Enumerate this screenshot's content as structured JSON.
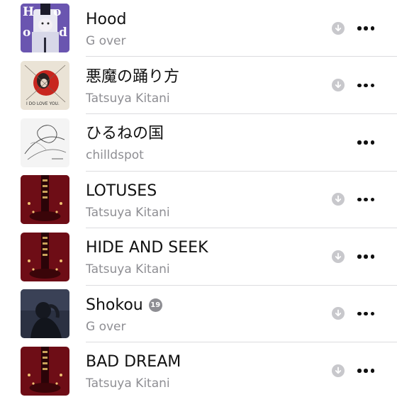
{
  "songs": [
    {
      "title": "Hood",
      "artist": "G over",
      "art": "hood-cover-art",
      "explicit": false,
      "download": true
    },
    {
      "title": "悪魔の踊り方",
      "artist": "Tatsuya Kitani",
      "art": "akuma-cover-art",
      "explicit": false,
      "download": true
    },
    {
      "title": "ひるねの国",
      "artist": "chilldspot",
      "art": "hirune-cover-art",
      "explicit": false,
      "download": false
    },
    {
      "title": "LOTUSES",
      "artist": "Tatsuya Kitani",
      "art": "red-room-cover-art",
      "explicit": false,
      "download": true
    },
    {
      "title": "HIDE AND SEEK",
      "artist": "Tatsuya Kitani",
      "art": "red-room-cover-art",
      "explicit": false,
      "download": true
    },
    {
      "title": "Shokou",
      "artist": "G over",
      "art": "shokou-cover-art",
      "explicit": true,
      "explicit_label": "19",
      "download": true
    },
    {
      "title": "BAD DREAM",
      "artist": "Tatsuya Kitani",
      "art": "red-room-cover-art",
      "explicit": false,
      "download": true
    }
  ],
  "cover_text": {
    "hood_letters": [
      "H",
      "o",
      "o",
      "d"
    ],
    "akuma_caption": "I DO LOVE YOU."
  },
  "colors": {
    "title": "#111111",
    "subtitle": "#8e8e93",
    "divider": "#dcdcdf",
    "download_icon": "#c8c8cc",
    "badge": "#8e8e93"
  }
}
